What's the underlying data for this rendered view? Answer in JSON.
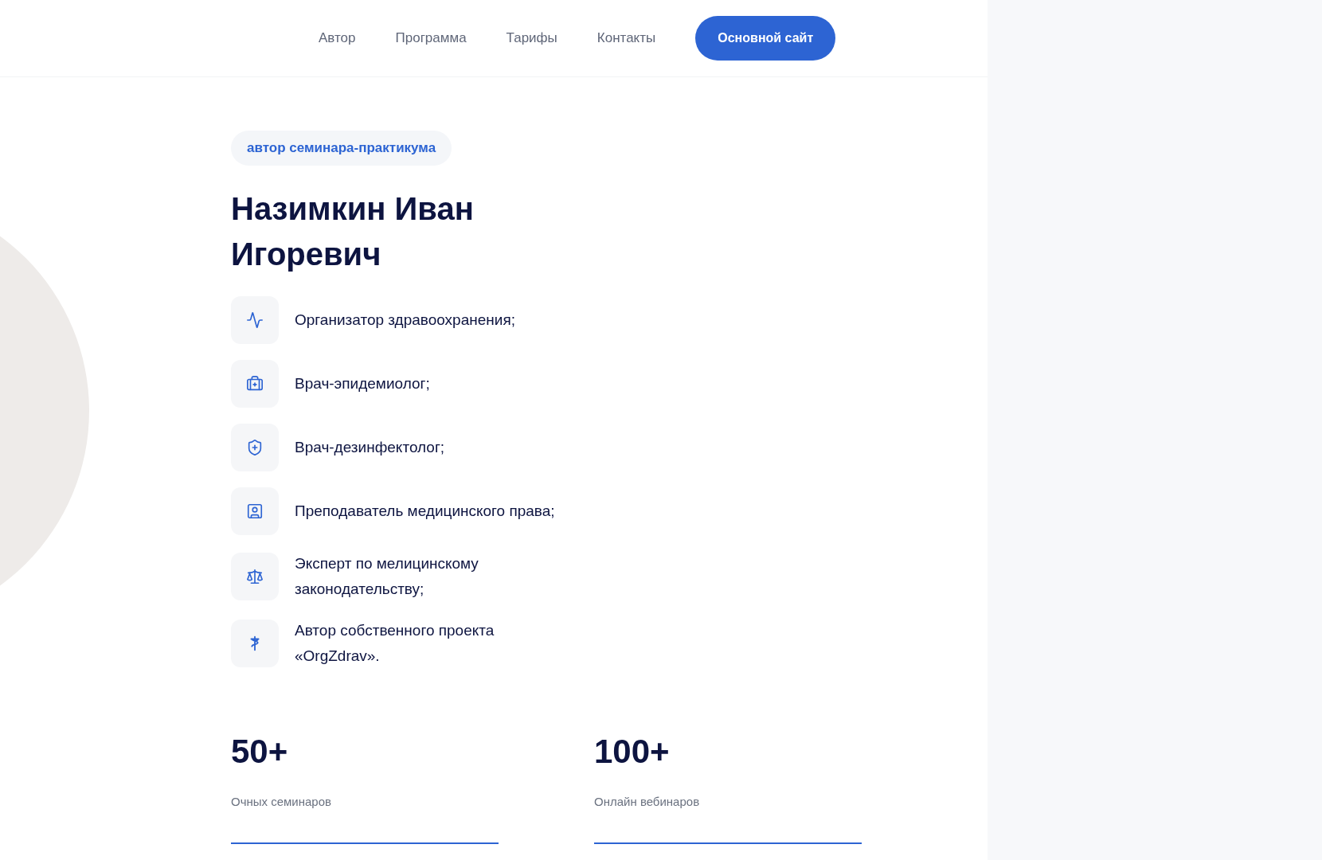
{
  "nav": {
    "links": [
      "Автор",
      "Программа",
      "Тарифы",
      "Контакты"
    ],
    "button": "Основной сайт"
  },
  "tag": "автор семинара-практикума",
  "name_lines": [
    "Назимкин Иван",
    "Игоревич"
  ],
  "roles": [
    {
      "text": "Организатор здравоохранения;"
    },
    {
      "text": "Врач-эпидемиолог;"
    },
    {
      "text": "Врач-дезинфектолог;"
    },
    {
      "text": "Преподаватель медицинского права;"
    },
    {
      "text": "Эксперт по мелицинскому законодательству;"
    },
    {
      "text": "Автор собственного проекта «OrgZdrav»."
    }
  ],
  "stats": [
    {
      "value": "50+",
      "label": "Очных семинаров"
    },
    {
      "value": "100+",
      "label": "Онлайн вебинаров"
    }
  ]
}
